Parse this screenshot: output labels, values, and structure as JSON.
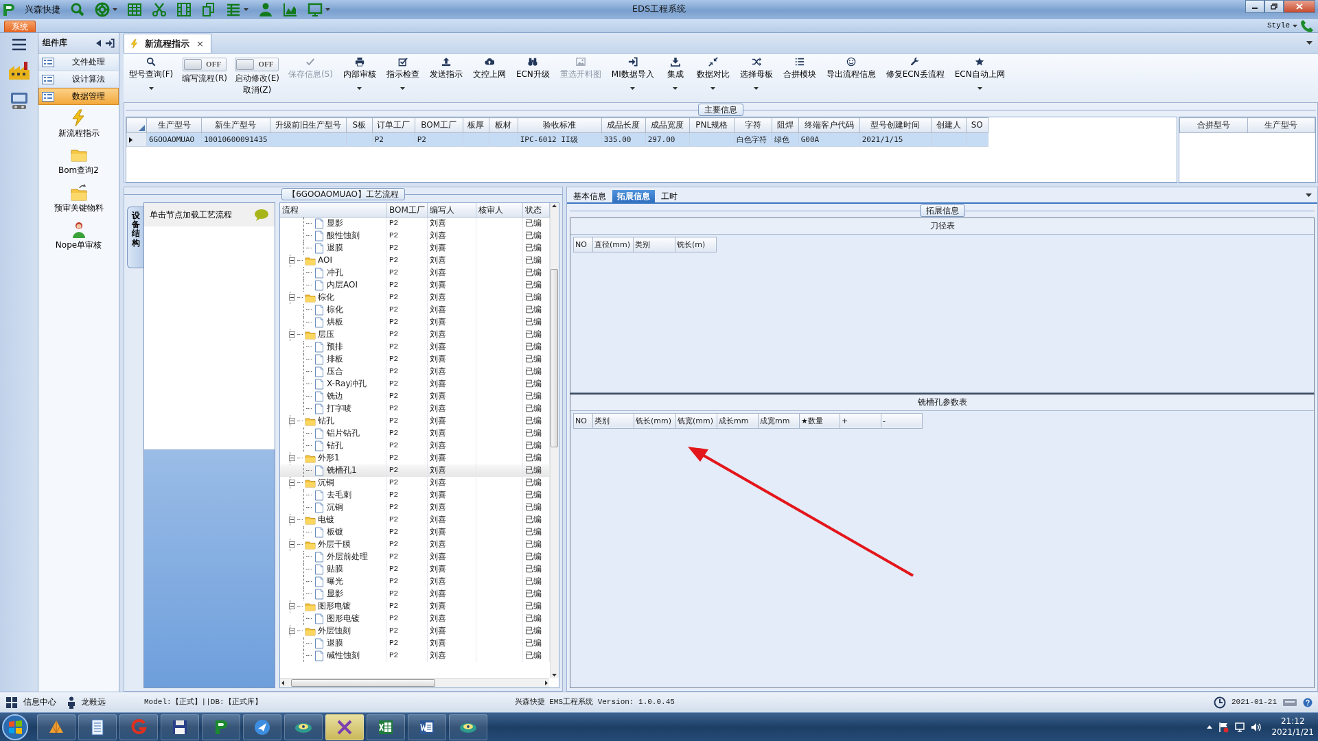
{
  "window": {
    "app_name": "兴森快捷",
    "title": "EDS工程系统"
  },
  "ribbon": {
    "tabs": [
      {
        "label": "系统",
        "selected": true
      }
    ],
    "style_menu": "Style"
  },
  "component_library": {
    "title": "组件库",
    "nav": [
      {
        "label": "文件处理",
        "selected": false
      },
      {
        "label": "设计算法",
        "selected": false
      },
      {
        "label": "数据管理",
        "selected": true
      }
    ],
    "tools": [
      {
        "label": "新流程指示"
      },
      {
        "label": "Bom查询2"
      },
      {
        "label": "预审关键物料"
      },
      {
        "label": "Nope单审核"
      }
    ]
  },
  "document_tabs": [
    {
      "label": "新流程指示",
      "selected": true,
      "close": "×"
    }
  ],
  "toolbar": [
    {
      "kind": "button",
      "label": "型号查询(F)",
      "disabled": false,
      "dropdown": true
    },
    {
      "kind": "toggle",
      "label": "编写流程(R)",
      "state_text": "OFF",
      "on": false
    },
    {
      "kind": "toggle",
      "label": "启动修改(E)",
      "sublabel": "取消(Z)",
      "state_text": "OFF",
      "on": false
    },
    {
      "kind": "button",
      "label": "保存信息(S)",
      "disabled": true,
      "dropdown": false
    },
    {
      "kind": "button",
      "label": "内部审核",
      "disabled": false,
      "dropdown": true
    },
    {
      "kind": "button",
      "label": "指示检查",
      "disabled": false,
      "dropdown": true
    },
    {
      "kind": "button",
      "label": "发送指示",
      "disabled": false,
      "dropdown": false
    },
    {
      "kind": "button",
      "label": "文控上网",
      "disabled": false,
      "dropdown": false
    },
    {
      "kind": "button",
      "label": "ECN升级",
      "disabled": false,
      "dropdown": false
    },
    {
      "kind": "button",
      "label": "重选开料图",
      "disabled": true,
      "dropdown": false
    },
    {
      "kind": "button",
      "label": "MI数据导入",
      "disabled": false,
      "dropdown": true
    },
    {
      "kind": "button",
      "label": "集成",
      "disabled": false,
      "dropdown": true
    },
    {
      "kind": "button",
      "label": "数据对比",
      "disabled": false,
      "dropdown": true
    },
    {
      "kind": "button",
      "label": "选择母板",
      "disabled": false,
      "dropdown": true
    },
    {
      "kind": "button",
      "label": "合拼模块",
      "disabled": false,
      "dropdown": false
    },
    {
      "kind": "button",
      "label": "导出流程信息",
      "disabled": false,
      "dropdown": false
    },
    {
      "kind": "button",
      "label": "修复ECN丢流程",
      "disabled": false,
      "dropdown": false
    },
    {
      "kind": "button",
      "label": "ECN自动上网",
      "disabled": false,
      "dropdown": true
    }
  ],
  "main_info": {
    "title": "主要信息",
    "columns": [
      "生产型号",
      "新生产型号",
      "升级前旧生产型号",
      "S板",
      "订单工厂",
      "BOM工厂",
      "板厚",
      "板材",
      "验收标准",
      "成品长度",
      "成品宽度",
      "PNL规格",
      "字符",
      "阻焊",
      "终端客户代码",
      "型号创建时间",
      "创建人",
      "SO"
    ],
    "rows": [
      {
        "selected": true,
        "cells": [
          "6GOOAOMUAO",
          "10010600091435",
          null,
          null,
          "P2",
          "P2",
          null,
          null,
          "IPC-6012 II级",
          "335.00",
          "297.00",
          null,
          "白色字符",
          "绿色",
          "G00A",
          "2021/1/15",
          null,
          null
        ]
      }
    ],
    "side_columns": [
      "合拼型号",
      "生产型号"
    ]
  },
  "process": {
    "title": "【6GOOAOMUAO】工艺流程",
    "side_tab": "设备结构",
    "hint": "单击节点加载工艺流程",
    "columns": [
      "流程",
      "BOM工厂",
      "编写人",
      "核审人",
      "状态"
    ],
    "tree": [
      {
        "children": [
          {
            "label": "显影",
            "bom": "P2",
            "writer": "刘喜",
            "status": "已编",
            "selected": false
          },
          {
            "label": "酸性蚀刻",
            "bom": "P2",
            "writer": "刘喜",
            "status": "已编",
            "selected": false
          },
          {
            "label": "退膜",
            "bom": "P2",
            "writer": "刘喜",
            "status": "已编",
            "selected": false
          }
        ]
      },
      {
        "label": "AOI",
        "bom": "P2",
        "writer": "刘喜",
        "status": "已编",
        "selected": false,
        "expanded": true,
        "children": [
          {
            "label": "冲孔",
            "bom": "P2",
            "writer": "刘喜",
            "status": "已编",
            "selected": false
          },
          {
            "label": "内层AOI",
            "bom": "P2",
            "writer": "刘喜",
            "status": "已编",
            "selected": false
          }
        ]
      },
      {
        "label": "棕化",
        "bom": "P2",
        "writer": "刘喜",
        "status": "已编",
        "selected": false,
        "expanded": true,
        "children": [
          {
            "label": "棕化",
            "bom": "P2",
            "writer": "刘喜",
            "status": "已编",
            "selected": false
          },
          {
            "label": "烘板",
            "bom": "P2",
            "writer": "刘喜",
            "status": "已编",
            "selected": false
          }
        ]
      },
      {
        "label": "层压",
        "bom": "P2",
        "writer": "刘喜",
        "status": "已编",
        "selected": false,
        "expanded": true,
        "children": [
          {
            "label": "预排",
            "bom": "P2",
            "writer": "刘喜",
            "status": "已编",
            "selected": false
          },
          {
            "label": "排板",
            "bom": "P2",
            "writer": "刘喜",
            "status": "已编",
            "selected": false
          },
          {
            "label": "压合",
            "bom": "P2",
            "writer": "刘喜",
            "status": "已编",
            "selected": false
          },
          {
            "label": "X-Ray冲孔",
            "bom": "P2",
            "writer": "刘喜",
            "status": "已编",
            "selected": false
          },
          {
            "label": "铣边",
            "bom": "P2",
            "writer": "刘喜",
            "status": "已编",
            "selected": false
          },
          {
            "label": "打字唛",
            "bom": "P2",
            "writer": "刘喜",
            "status": "已编",
            "selected": false
          }
        ]
      },
      {
        "label": "钻孔",
        "bom": "P2",
        "writer": "刘喜",
        "status": "已编",
        "selected": false,
        "expanded": true,
        "children": [
          {
            "label": "铝片钻孔",
            "bom": "P2",
            "writer": "刘喜",
            "status": "已编",
            "selected": false
          },
          {
            "label": "钻孔",
            "bom": "P2",
            "writer": "刘喜",
            "status": "已编",
            "selected": false
          }
        ]
      },
      {
        "label": "外形1",
        "bom": "P2",
        "writer": "刘喜",
        "status": "已编",
        "selected": false,
        "expanded": true,
        "children": [
          {
            "label": "铣槽孔1",
            "bom": "P2",
            "writer": "刘喜",
            "status": "已编",
            "selected": true
          }
        ]
      },
      {
        "label": "沉铜",
        "bom": "P2",
        "writer": "刘喜",
        "status": "已编",
        "selected": false,
        "expanded": true,
        "children": [
          {
            "label": "去毛刺",
            "bom": "P2",
            "writer": "刘喜",
            "status": "已编",
            "selected": false
          },
          {
            "label": "沉铜",
            "bom": "P2",
            "writer": "刘喜",
            "status": "已编",
            "selected": false
          }
        ]
      },
      {
        "label": "电镀",
        "bom": "P2",
        "writer": "刘喜",
        "status": "已编",
        "selected": false,
        "expanded": true,
        "children": [
          {
            "label": "板镀",
            "bom": "P2",
            "writer": "刘喜",
            "status": "已编",
            "selected": false
          }
        ]
      },
      {
        "label": "外层干膜",
        "bom": "P2",
        "writer": "刘喜",
        "status": "已编",
        "selected": false,
        "expanded": true,
        "children": [
          {
            "label": "外层前处理",
            "bom": "P2",
            "writer": "刘喜",
            "status": "已编",
            "selected": false
          },
          {
            "label": "贴膜",
            "bom": "P2",
            "writer": "刘喜",
            "status": "已编",
            "selected": false
          },
          {
            "label": "曝光",
            "bom": "P2",
            "writer": "刘喜",
            "status": "已编",
            "selected": false
          },
          {
            "label": "显影",
            "bom": "P2",
            "writer": "刘喜",
            "status": "已编",
            "selected": false
          }
        ]
      },
      {
        "label": "图形电镀",
        "bom": "P2",
        "writer": "刘喜",
        "status": "已编",
        "selected": false,
        "expanded": true,
        "children": [
          {
            "label": "图形电镀",
            "bom": "P2",
            "writer": "刘喜",
            "status": "已编",
            "selected": false
          }
        ]
      },
      {
        "label": "外层蚀刻",
        "bom": "P2",
        "writer": "刘喜",
        "status": "已编",
        "selected": false,
        "expanded": true,
        "children": [
          {
            "label": "退膜",
            "bom": "P2",
            "writer": "刘喜",
            "status": "已编",
            "selected": false
          },
          {
            "label": "碱性蚀刻",
            "bom": "P2",
            "writer": "刘喜",
            "status": "已编",
            "selected": false
          }
        ]
      }
    ]
  },
  "detail": {
    "tabs": [
      {
        "label": "基本信息",
        "selected": false
      },
      {
        "label": "拓展信息",
        "selected": true
      },
      {
        "label": "工时",
        "selected": false
      }
    ],
    "title": "拓展信息",
    "tables": [
      {
        "title": "刀径表",
        "columns": [
          "NO",
          "直径(mm)",
          "类别",
          "铣长(m)"
        ]
      },
      {
        "title": "铣槽孔参数表",
        "columns": [
          "NO",
          "类别",
          "铣长(mm)",
          "铣宽(mm)",
          "成长mm",
          "成宽mm",
          "★数量",
          "+",
          "-"
        ]
      }
    ]
  },
  "status_bar": {
    "info_center": "信息中心",
    "user": "龙毅远",
    "model": "Model:【正式】||DB:【正式库】",
    "version": "兴森快捷 EMS工程系统 Version: 1.0.0.45",
    "date": "2021-01-21"
  },
  "taskbar": {
    "time": "21:12",
    "date": "2021/1/21"
  }
}
